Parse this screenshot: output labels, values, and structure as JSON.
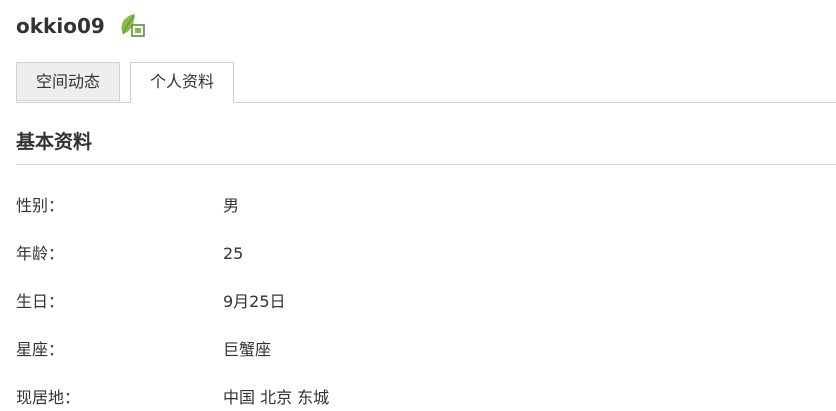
{
  "profile": {
    "username": "okkio09",
    "badge_icon": "leaf-icon"
  },
  "tabs": [
    {
      "label": "空间动态",
      "active": false
    },
    {
      "label": "个人资料",
      "active": true
    }
  ],
  "section": {
    "title": "基本资料"
  },
  "fields": [
    {
      "label": "性别：",
      "value": "男"
    },
    {
      "label": "年龄：",
      "value": "25"
    },
    {
      "label": "生日：",
      "value": "9月25日"
    },
    {
      "label": "星座：",
      "value": "巨蟹座"
    },
    {
      "label": "现居地：",
      "value": "中国 北京 东城"
    }
  ],
  "colors": {
    "text": "#333333",
    "tab_inactive_bg": "#eeeeee",
    "border": "#cfcfcf",
    "leaf_green": "#8ab84a"
  }
}
